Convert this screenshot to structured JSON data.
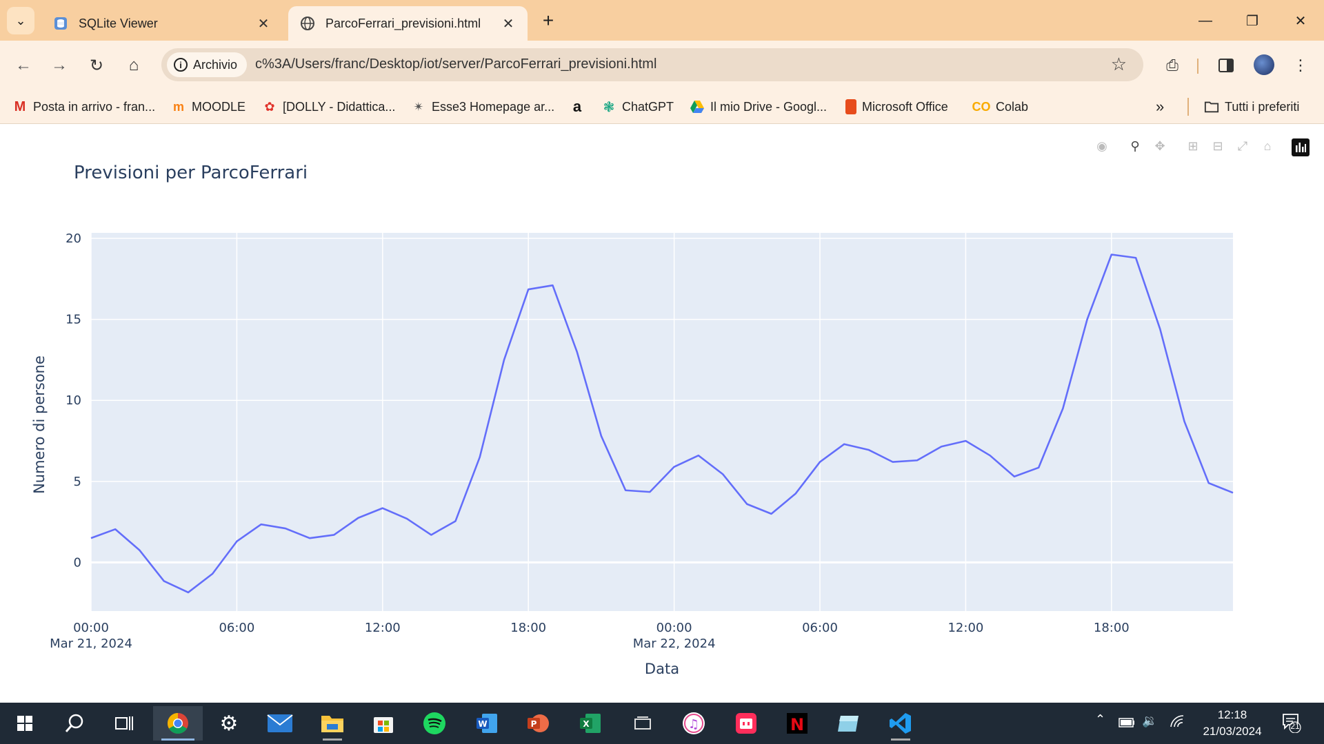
{
  "browser": {
    "tabs": [
      {
        "title": "SQLite Viewer",
        "active": false
      },
      {
        "title": "ParcoFerrari_previsioni.html",
        "active": true
      }
    ],
    "security_chip": "Archivio",
    "url": "c%3A/Users/franc/Desktop/iot/server/ParcoFerrari_previsioni.html",
    "bookmarks": [
      {
        "label": "Posta in arrivo - fran...",
        "icon": "gmail-icon"
      },
      {
        "label": "MOODLE",
        "icon": "moodle-icon"
      },
      {
        "label": "[DOLLY - Didattica...",
        "icon": "dolly-icon"
      },
      {
        "label": "Esse3 Homepage ar...",
        "icon": "esse3-icon"
      },
      {
        "label": "",
        "icon": "amazon-icon"
      },
      {
        "label": "ChatGPT",
        "icon": "chatgpt-icon"
      },
      {
        "label": "Il mio Drive - Googl...",
        "icon": "drive-icon"
      },
      {
        "label": "Microsoft Office",
        "icon": "office-icon"
      },
      {
        "label": "Colab",
        "icon": "colab-icon"
      }
    ],
    "all_bookmarks": "Tutti i preferiti"
  },
  "chart_data": {
    "type": "line",
    "title": "Previsioni per ParcoFerrari",
    "xlabel": "Data",
    "ylabel": "Numero di persone",
    "x_start": "2024-03-21 00:00",
    "x_step_hours": 1,
    "x_range_hours": [
      0,
      47
    ],
    "ylim": [
      -3,
      20
    ],
    "yticks": [
      0,
      5,
      10,
      15,
      20
    ],
    "xticks": [
      {
        "hour": 0,
        "label": "00:00",
        "sublabel": "Mar 21, 2024"
      },
      {
        "hour": 6,
        "label": "06:00",
        "sublabel": ""
      },
      {
        "hour": 12,
        "label": "12:00",
        "sublabel": ""
      },
      {
        "hour": 18,
        "label": "18:00",
        "sublabel": ""
      },
      {
        "hour": 24,
        "label": "00:00",
        "sublabel": "Mar 22, 2024"
      },
      {
        "hour": 30,
        "label": "06:00",
        "sublabel": ""
      },
      {
        "hour": 36,
        "label": "12:00",
        "sublabel": ""
      },
      {
        "hour": 42,
        "label": "18:00",
        "sublabel": ""
      }
    ],
    "grid": true,
    "series": [
      {
        "color": "#636efa",
        "values": [
          1.5,
          2.05,
          0.75,
          -1.15,
          -1.85,
          -0.7,
          1.3,
          2.35,
          2.1,
          1.5,
          1.7,
          2.75,
          3.35,
          2.7,
          1.7,
          2.55,
          6.5,
          12.5,
          16.85,
          17.1,
          13.0,
          7.8,
          4.45,
          4.35,
          5.9,
          6.6,
          5.45,
          3.6,
          3.0,
          4.25,
          6.2,
          7.3,
          6.95,
          6.2,
          6.3,
          7.15,
          7.5,
          6.6,
          5.3,
          5.85,
          9.5,
          15.0,
          19.0,
          18.8,
          14.4,
          8.7,
          4.9,
          4.3
        ]
      }
    ]
  },
  "taskbar": {
    "time": "12:18",
    "date": "21/03/2024",
    "notifications": "21"
  }
}
